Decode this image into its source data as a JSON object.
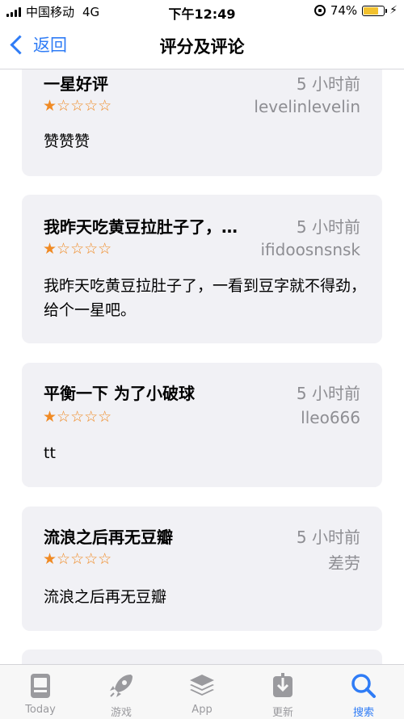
{
  "status_bar": {
    "carrier": "中国移动",
    "network": "4G",
    "time": "下午12:49",
    "battery": "74%",
    "battery_level": 0.74
  },
  "nav": {
    "back_label": "返回",
    "title": "评分及评论"
  },
  "reviews": [
    {
      "title": "一星好评",
      "time": "5 小时前",
      "author": "levelinlevelin",
      "rating": 1,
      "stars": "★☆☆☆☆",
      "body": "赞赞赞"
    },
    {
      "title": "我昨天吃黄豆拉肚子了，…",
      "time": "5 小时前",
      "author": "ifidoosnsnsk",
      "rating": 1,
      "stars": "★☆☆☆☆",
      "body": "我昨天吃黄豆拉肚子了，一看到豆字就不得劲，给个一星吧。"
    },
    {
      "title": "平衡一下 为了小破球",
      "time": "5 小时前",
      "author": "lleo666",
      "rating": 1,
      "stars": "★☆☆☆☆",
      "body": "tt"
    },
    {
      "title": "流浪之后再无豆瓣",
      "time": "5 小时前",
      "author": "差劳",
      "rating": 1,
      "stars": "★☆☆☆☆",
      "body": "流浪之后再无豆瓣"
    }
  ],
  "tabs": [
    {
      "label": "Today",
      "icon": "today-icon"
    },
    {
      "label": "游戏",
      "icon": "rocket-icon"
    },
    {
      "label": "App",
      "icon": "app-stack-icon"
    },
    {
      "label": "更新",
      "icon": "download-icon"
    },
    {
      "label": "搜索",
      "icon": "search-icon"
    }
  ],
  "colors": {
    "accent": "#2f7cf6",
    "star": "#f08a24",
    "card_bg": "#f1f1f5",
    "secondary_text": "#8e8e93"
  }
}
